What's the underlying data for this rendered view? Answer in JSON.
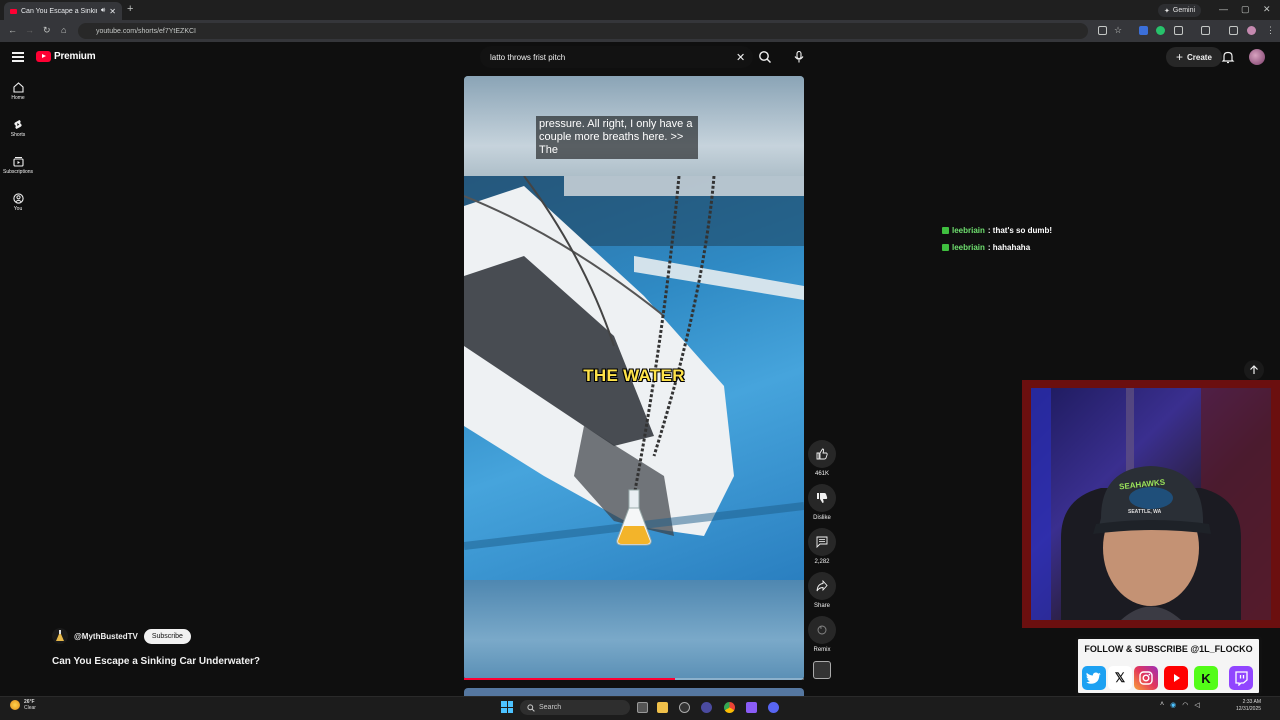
{
  "browser": {
    "tab_title": "Can You Escape a Sinking C",
    "url": "youtube.com/shorts/ef7YtEZKCI",
    "gemini_label": "Gemini"
  },
  "header": {
    "logo_text": "Premium",
    "search_value": "latto throws frist pitch",
    "create_label": "Create"
  },
  "nav": {
    "items": [
      {
        "label": "Home",
        "icon": "home-icon"
      },
      {
        "label": "Shorts",
        "icon": "shorts-icon"
      },
      {
        "label": "Subscriptions",
        "icon": "subscriptions-icon"
      },
      {
        "label": "You",
        "icon": "you-icon"
      }
    ]
  },
  "video": {
    "caption": "pressure. All right, I only have a couple more breaths here. >> The",
    "overlay_text": "THE WATER",
    "progress": 0.62
  },
  "actions": {
    "likes": "461K",
    "dislike_label": "Dislike",
    "comments": "2,282",
    "share_label": "Share",
    "remix_label": "Remix"
  },
  "channel": {
    "handle": "@MythBustedTV",
    "subscribe_label": "Subscribe",
    "video_title": "Can You Escape a Sinking Car Underwater?"
  },
  "chat": [
    {
      "user": "leebriain",
      "message": ": that's so dumb!"
    },
    {
      "user": "leebriain",
      "message": ": hahahaha"
    }
  ],
  "overlay": {
    "follow_text": "FOLLOW & SUBSCRIBE @1L_FLOCKO",
    "cap_text": "SEAHAWKS",
    "cap_subtext": "SEATTLE, WA"
  },
  "taskbar": {
    "weather_temp": "26°F",
    "weather_desc": "Clear",
    "search_label": "Search",
    "time": "2:33 AM",
    "date": "12/31/2025"
  },
  "colors": {
    "youtube_red": "#ff0033",
    "background": "#0f0f0f",
    "chat_user": "#6fe06f",
    "overlay_yellow": "#ffe34a",
    "cam_frame": "#6b0f0f"
  }
}
